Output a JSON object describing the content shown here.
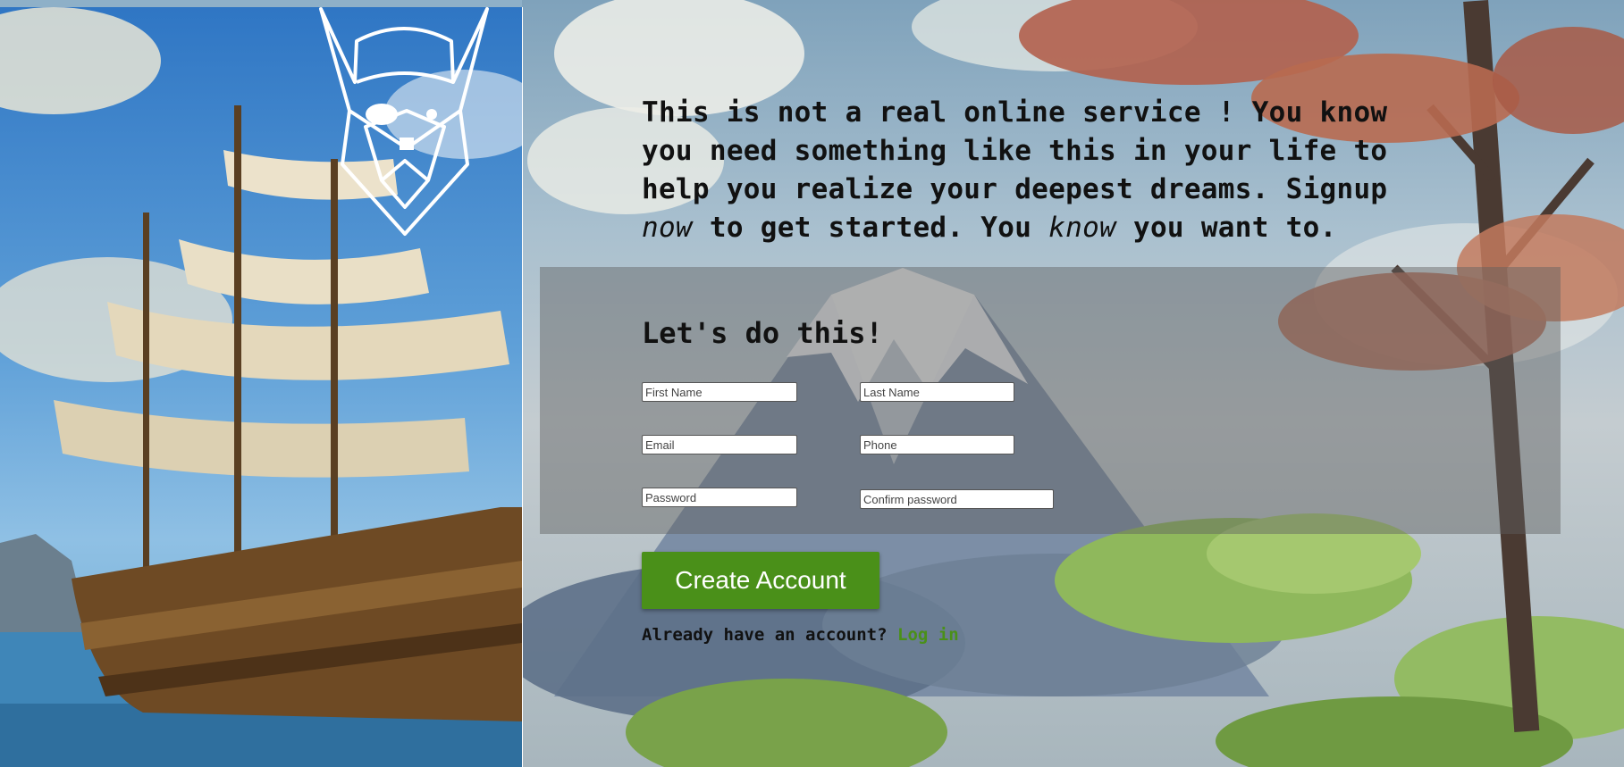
{
  "intro": {
    "part1": "This is not a real online service ! You know you need something like this in your life to help you realize your deepest dreams. Signup",
    "em1": "now",
    "part2": "to get started. You",
    "em2": "know",
    "part3": "you want to."
  },
  "form": {
    "title": "Let's do this!",
    "first_name_placeholder": "First Name",
    "last_name_placeholder": "Last Name",
    "email_placeholder": "Email",
    "phone_placeholder": "Phone",
    "password_placeholder": "Password",
    "confirm_password_placeholder": "Confirm password",
    "submit_label": "Create Account"
  },
  "login": {
    "prompt": "Already have an account?",
    "link_label": "Log in"
  },
  "colors": {
    "accent": "#4a9019",
    "panel": "#5f5f5f"
  },
  "icons": {
    "logo": "viking-helmet-logo-icon"
  }
}
